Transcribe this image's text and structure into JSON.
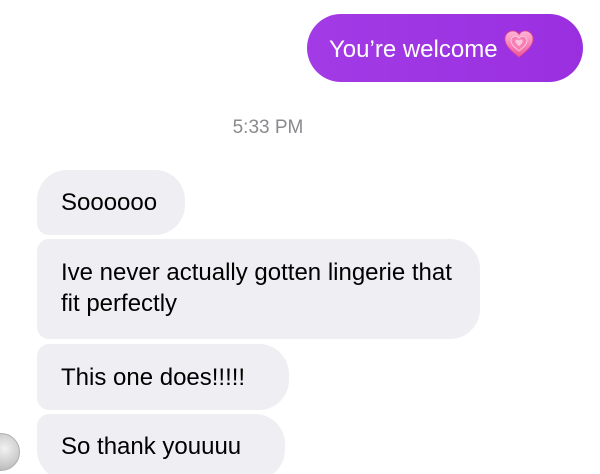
{
  "conversation": {
    "sent_messages": [
      {
        "text": "You’re welcome",
        "emoji": "growing-heart-icon",
        "color": "#a033e4"
      }
    ],
    "timestamp": "5:33 PM",
    "received_messages": [
      {
        "text": "Soooooo"
      },
      {
        "text": "Ive never actually gotten lingerie that fit perfectly"
      },
      {
        "text": "This one does!!!!!"
      },
      {
        "text": "So thank youuuu"
      }
    ]
  },
  "colors": {
    "sent_bubble": "#a033e4",
    "received_bubble": "#efeff3",
    "timestamp": "#8a8a8e"
  }
}
